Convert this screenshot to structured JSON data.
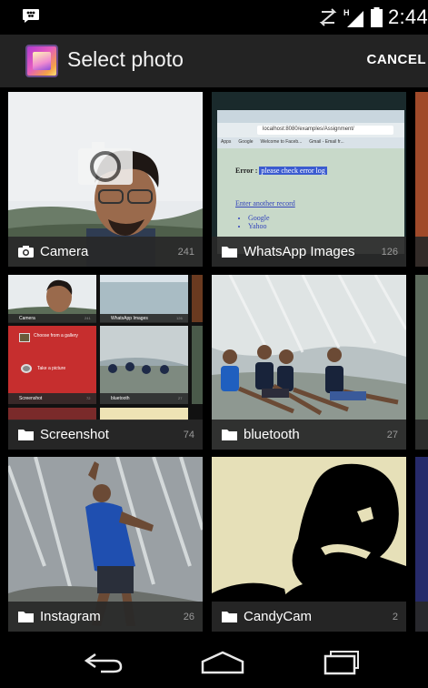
{
  "status_bar": {
    "time": "2:44",
    "icons": [
      "bbm-notification-icon",
      "sync-icon",
      "signal-icon",
      "battery-icon"
    ]
  },
  "action_bar": {
    "title": "Select photo",
    "cancel_label": "CANCEL",
    "app_icon": "photo-editor-app-icon"
  },
  "albums": [
    {
      "name": "Camera",
      "count": "241",
      "icon": "camera-icon"
    },
    {
      "name": "WhatsApp Images",
      "count": "126",
      "icon": "folder-icon"
    },
    {
      "name": "Screenshot",
      "count": "74",
      "icon": "folder-icon"
    },
    {
      "name": "bluetooth",
      "count": "27",
      "icon": "folder-icon"
    },
    {
      "name": "Instagram",
      "count": "26",
      "icon": "folder-icon"
    },
    {
      "name": "CandyCam",
      "count": "2",
      "icon": "folder-icon"
    }
  ],
  "screenshot_thumb": {
    "mini_albums": [
      {
        "name": "Camera",
        "count": "241"
      },
      {
        "name": "WhatsApp Images",
        "count": "126"
      },
      {
        "name": "Screenshot",
        "count": "72"
      },
      {
        "name": "bluetooth",
        "count": "27"
      }
    ],
    "dialog_items": [
      "Choose from a gallery",
      "Take a picture"
    ]
  },
  "browser_thumb": {
    "url": "localhost:8080/examples/Assignment/",
    "bookmarks": [
      "Apps",
      "Google",
      "Welcome to Faceb...",
      "Gmail - Email fr..."
    ],
    "error_label": "Error :",
    "error_text": "please check error log",
    "link_text": "Enter another record",
    "list_items": [
      "Google",
      "Yahoo"
    ]
  },
  "nav_bar": {
    "buttons": [
      "back-icon",
      "home-icon",
      "recents-icon"
    ]
  }
}
